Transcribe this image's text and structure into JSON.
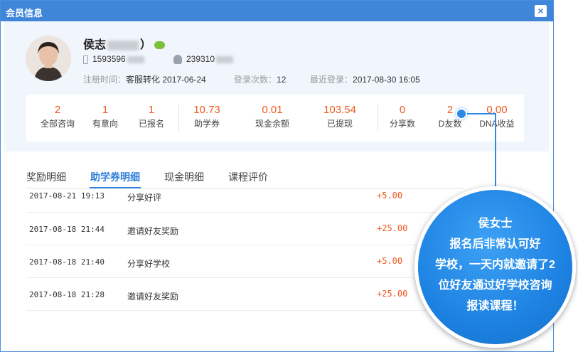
{
  "window": {
    "title": "会员信息",
    "close_label": "×"
  },
  "profile": {
    "name_prefix": "侯志",
    "name_suffix": "）",
    "phone_visible": "1593596",
    "qq_visible": "239310",
    "reg_label": "注册时间：",
    "reg_value": "客服转化 2017-06-24",
    "login_count_label": "登录次数：",
    "login_count_value": "12",
    "last_login_label": "最近登录：",
    "last_login_value": "2017-08-30 16:05"
  },
  "stats": [
    {
      "num": "2",
      "label": "全部咨询"
    },
    {
      "num": "1",
      "label": "有意向"
    },
    {
      "num": "1",
      "label": "已报名"
    },
    {
      "num": "10.73",
      "label": "助学券"
    },
    {
      "num": "0.01",
      "label": "现金余额"
    },
    {
      "num": "103.54",
      "label": "已提现"
    },
    {
      "num": "0",
      "label": "分享数"
    },
    {
      "num": "2",
      "label": "D友数"
    },
    {
      "num": "0.00",
      "label": "DNA收益"
    }
  ],
  "tabs": [
    {
      "label": "奖励明细",
      "active": false
    },
    {
      "label": "助学券明细",
      "active": true
    },
    {
      "label": "现金明细",
      "active": false
    },
    {
      "label": "课程评价",
      "active": false
    }
  ],
  "records": [
    {
      "datetime": "2017-08-21 19:13",
      "desc": "分享好评",
      "amount": "+5.00"
    },
    {
      "datetime": "2017-08-18 21:44",
      "desc": "邀请好友奖励",
      "amount": "+25.00"
    },
    {
      "datetime": "2017-08-18 21:40",
      "desc": "分享好学校",
      "amount": "+5.00"
    },
    {
      "datetime": "2017-08-18 21:28",
      "desc": "邀请好友奖励",
      "amount": "+25.00"
    }
  ],
  "callout": {
    "lines": [
      "侯女士",
      "报名后非常认可好",
      "学校，一天内就邀请了2",
      "位好友通过好学校咨询",
      "报读课程！"
    ]
  },
  "colors": {
    "title_bar": "#3f86d8",
    "accent": "#2f7ed8",
    "value_orange": "#ee5a22",
    "callout_blue": "#1d82e2"
  }
}
